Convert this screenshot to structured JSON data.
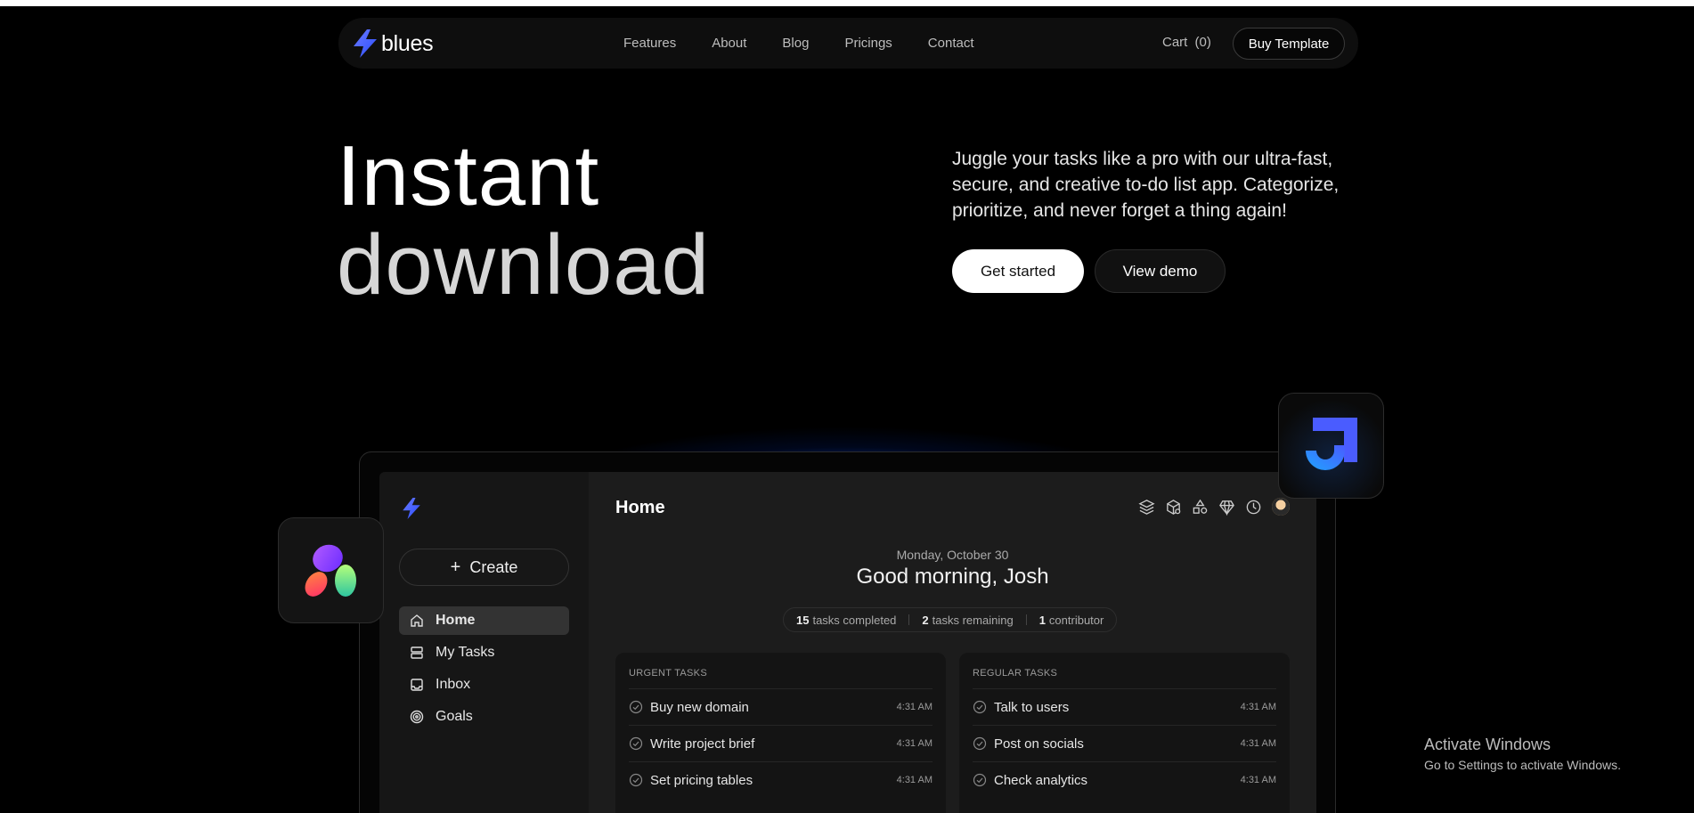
{
  "nav": {
    "logo_text": "blues",
    "links": [
      "Features",
      "About",
      "Blog",
      "Pricings",
      "Contact"
    ],
    "cart_label": "Cart",
    "cart_count": "(0)",
    "buy_label": "Buy Template"
  },
  "hero": {
    "line1": "Instant",
    "line2": "download",
    "description": "Juggle your tasks like a pro with our ultra-fast, secure, and creative to-do list app. Categorize, prioritize, and never forget a thing again!",
    "primary_cta": "Get started",
    "secondary_cta": "View demo"
  },
  "app": {
    "create_label": "Create",
    "sidebar_items": [
      {
        "label": "Home",
        "icon": "home-icon",
        "active": true
      },
      {
        "label": "My Tasks",
        "icon": "tasks-icon",
        "active": false
      },
      {
        "label": "Inbox",
        "icon": "inbox-icon",
        "active": false
      },
      {
        "label": "Goals",
        "icon": "target-icon",
        "active": false
      }
    ],
    "page_title": "Home",
    "header_icons": [
      "layers-icon",
      "box-icon",
      "shapes-icon",
      "diamond-icon",
      "clock-icon",
      "avatar"
    ],
    "date": "Monday, October 30",
    "greeting": "Good morning, Josh",
    "stats": {
      "completed_count": "15",
      "completed_label": "tasks completed",
      "remaining_count": "2",
      "remaining_label": "tasks remaining",
      "contributor_count": "1",
      "contributor_label": "contributor"
    },
    "urgent": {
      "title": "URGENT TASKS",
      "tasks": [
        {
          "name": "Buy new domain",
          "time": "4:31 AM"
        },
        {
          "name": "Write project brief",
          "time": "4:31 AM"
        },
        {
          "name": "Set pricing tables",
          "time": "4:31 AM"
        }
      ]
    },
    "regular": {
      "title": "REGULAR TASKS",
      "tasks": [
        {
          "name": "Talk to users",
          "time": "4:31 AM"
        },
        {
          "name": "Post on socials",
          "time": "4:31 AM"
        },
        {
          "name": "Check analytics",
          "time": "4:31 AM"
        }
      ]
    }
  },
  "watermark": {
    "line1": "Activate Windows",
    "line2": "Go to Settings to activate Windows."
  },
  "colors": {
    "accent_blue": "#3f6bff",
    "background": "#000000",
    "surface": "#1c1c1c"
  }
}
